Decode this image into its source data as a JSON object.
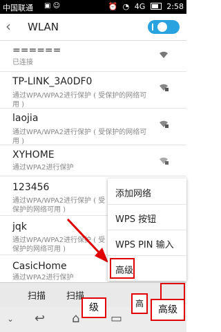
{
  "status_bar": {
    "carrier": "中国联通",
    "time": "2:58",
    "network": "4G"
  },
  "header": {
    "title": "WLAN",
    "toggle_state": "on"
  },
  "networks": [
    {
      "ssid": "======",
      "status": "已连接"
    },
    {
      "ssid": "TP-LINK_3A0DF0",
      "status": "通过WPA/WPA2进行保护 ( 受保护的网络可用 )"
    },
    {
      "ssid": "laojia",
      "status": "通过WPA/WPA2进行保护 ( 受保护的网络可用 )"
    },
    {
      "ssid": "XYHOME",
      "status": "通过WPA2进行保护"
    },
    {
      "ssid": "123456",
      "status": "通过WPA/WPA2进行保护 ( 受保护的网络可用 )"
    },
    {
      "ssid": "jqk",
      "status": "通过WPA/WPA2进行保护 ( 受保护的网络可用 )"
    },
    {
      "ssid": "CasicHome",
      "status": "通过WPA2进行保护"
    }
  ],
  "menu": {
    "items": [
      "添加网络",
      "WPS 按钮",
      "WPS PIN 输入",
      "高级"
    ]
  },
  "bottom_bar": {
    "scan_left": "扫描",
    "scan_right": "扫描"
  },
  "annotation_callouts": {
    "left": "级",
    "middle": "高",
    "right": "高级"
  },
  "colors": {
    "accent": "#29a3e0",
    "annotation_red": "#e00000"
  }
}
